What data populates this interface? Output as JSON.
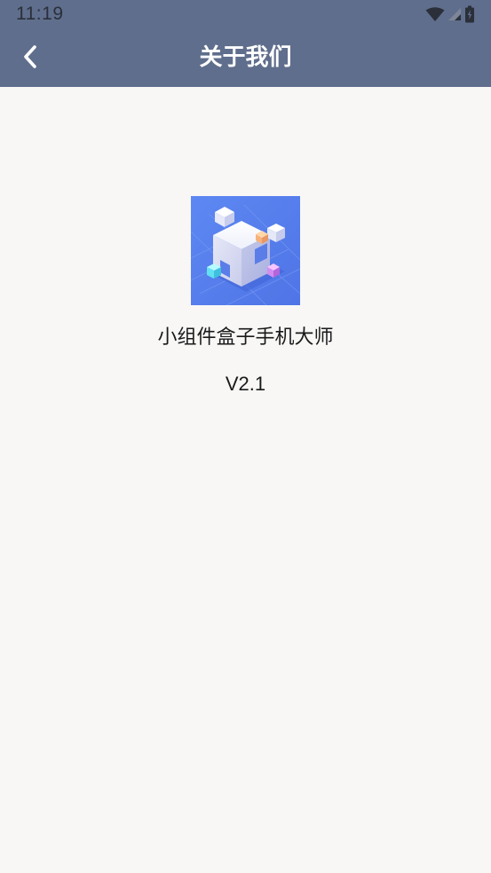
{
  "status_bar": {
    "time": "11:19",
    "icons": [
      "wifi-icon",
      "cellular-signal-icon",
      "battery-icon"
    ]
  },
  "header": {
    "title": "关于我们",
    "back_icon": "chevron-left-icon",
    "background_color": "#5f6e8c"
  },
  "about": {
    "app_name": "小组件盒子手机大师",
    "version": "V2.1",
    "logo_icon": "stacked-cubes-logo"
  },
  "colors": {
    "page_background": "#f8f7f6",
    "logo_background": "#5a84ee"
  }
}
